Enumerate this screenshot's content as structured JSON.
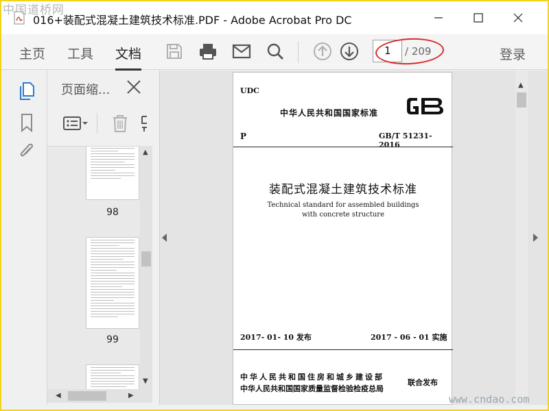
{
  "window": {
    "title": "016+装配式混凝土建筑技术标准.PDF - Adobe Acrobat Pro DC",
    "watermark_top": "中国道桥网",
    "watermark_bottom": "www.cndao.com"
  },
  "toolbar": {
    "tabs": [
      "主页",
      "工具",
      "文档"
    ],
    "active_tab": "文档",
    "page_current": "1",
    "page_total": "/ 209",
    "login_label": "登录"
  },
  "thumbnails": {
    "panel_title": "页面缩...",
    "pages": [
      {
        "label": "98"
      },
      {
        "label": "99"
      }
    ]
  },
  "document": {
    "udc": "UDC",
    "standard_type": "中华人民共和国国家标准",
    "gb_logo": "GB",
    "category": "P",
    "code": "GB/T 51231-2016",
    "title_zh": "装配式混凝土建筑技术标准",
    "title_en_line1": "Technical standard for assembled buildings",
    "title_en_line2": "with concrete structure",
    "issue": "2017- 01- 10   发布",
    "implement": "2017 - 06 - 01   实施",
    "org1": "中华人民共和国住房和城乡建设部",
    "org2": "中华人民共和国国家质量监督检验检疫总局",
    "joint": "联合发布"
  },
  "colors": {
    "accent": "#2a7ad1",
    "highlight_oval": "#d72b2b",
    "frame_border": "#f2d21a"
  },
  "icons": {
    "app": "acrobat-pdf-icon",
    "minimize": "minimize-icon",
    "maximize": "maximize-icon",
    "close": "close-icon",
    "save": "save-icon",
    "print": "print-icon",
    "email": "email-icon",
    "search": "search-icon",
    "prev_page": "arrow-up-circle-icon",
    "next_page": "arrow-down-circle-icon",
    "thumbnails": "page-thumbnails-icon",
    "bookmarks": "bookmark-icon",
    "attachments": "paperclip-icon",
    "options": "options-list-icon",
    "delete": "trash-icon"
  }
}
